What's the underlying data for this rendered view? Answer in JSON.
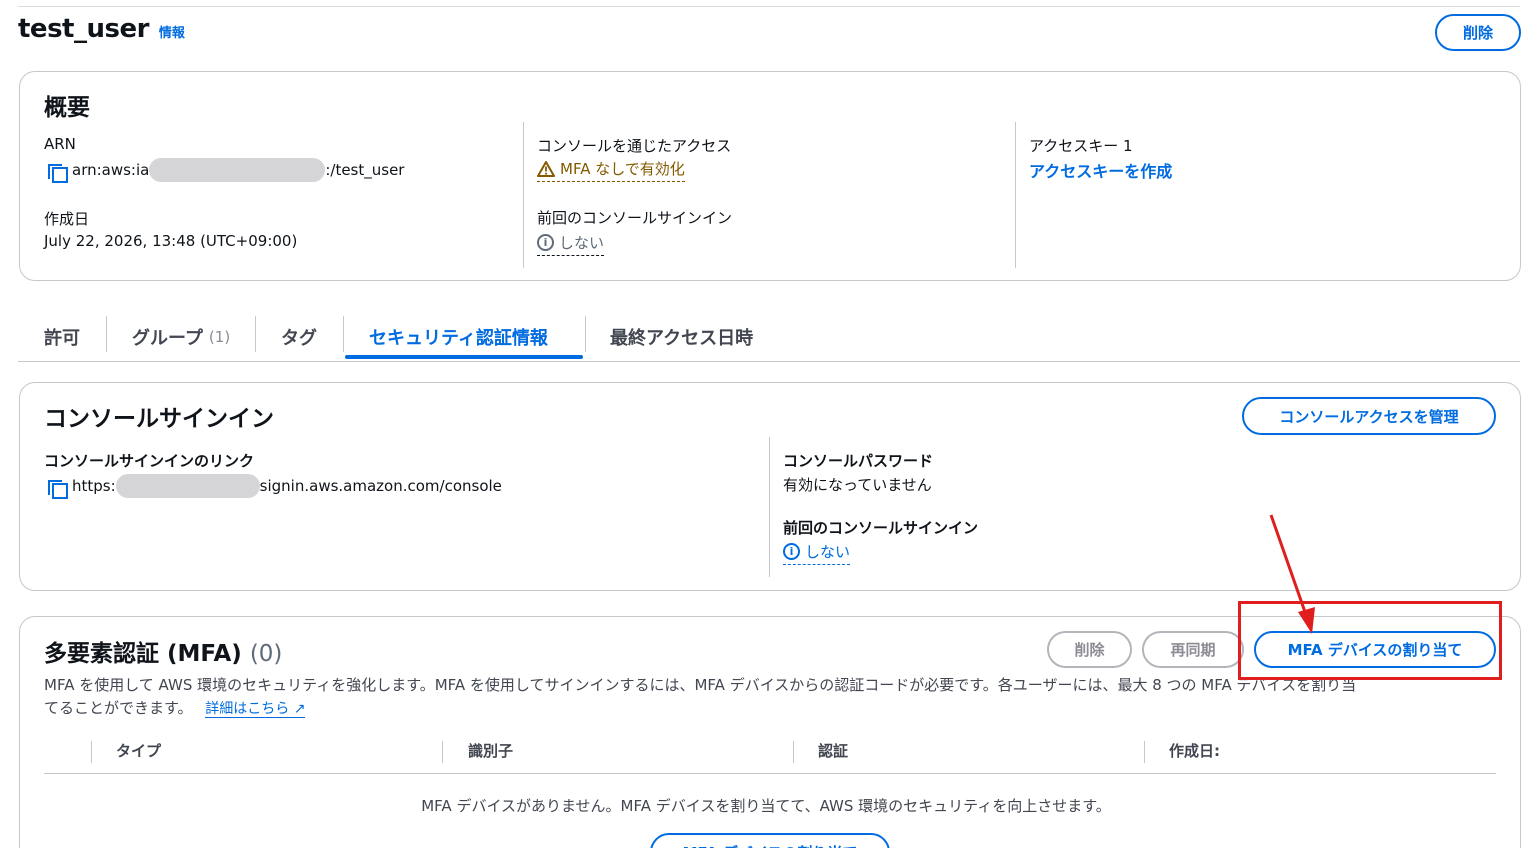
{
  "header": {
    "title": "test_user",
    "info": "情報",
    "delete_label": "削除"
  },
  "summary": {
    "title": "概要",
    "arn_label": "ARN",
    "arn_prefix": "arn:aws:ia",
    "arn_suffix": ":/test_user",
    "created_label": "作成日",
    "created_value": "July 22, 2026, 13:48 (UTC+09:00)",
    "console_access_label": "コンソールを通じたアクセス",
    "console_access_value": "MFA なしで有効化",
    "last_signin_label": "前回のコンソールサインイン",
    "last_signin_value": "しない",
    "access_key_label": "アクセスキー 1",
    "access_key_link": "アクセスキーを作成"
  },
  "tabs": [
    {
      "label": "許可"
    },
    {
      "label": "グループ",
      "count": "(1)"
    },
    {
      "label": "タグ"
    },
    {
      "label": "セキュリティ認証情報",
      "active": true
    },
    {
      "label": "最終アクセス日時"
    }
  ],
  "console_signin": {
    "title": "コンソールサインイン",
    "manage_button": "コンソールアクセスを管理",
    "link_label": "コンソールサインインのリンク",
    "link_prefix": "https:",
    "link_suffix": "signin.aws.amazon.com/console",
    "password_label": "コンソールパスワード",
    "password_value": "有効になっていません",
    "last_signin_label": "前回のコンソールサインイン",
    "last_signin_value": "しない"
  },
  "mfa": {
    "title": "多要素認証 (MFA)",
    "count": "(0)",
    "delete_button": "削除",
    "resync_button": "再同期",
    "assign_button": "MFA デバイスの割り当て",
    "description_line1": "MFA を使用して AWS 環境のセキュリティを強化します。MFA を使用してサインインするには、MFA デバイスからの認証コードが必要です。各ユーザーには、最大 8 つの MFA デバイスを割り当",
    "description_line2": "てることができます。",
    "details_link": "詳細はこちら",
    "columns": [
      "タイプ",
      "識別子",
      "認証",
      "作成日:"
    ],
    "empty_message": "MFA デバイスがありません。MFA デバイスを割り当てて、AWS 環境のセキュリティを向上させます。",
    "empty_button": "MFA デバイスの割り当て"
  },
  "colors": {
    "accent": "#006ce0",
    "warning": "#855900",
    "annotation": "#e01e1e"
  }
}
